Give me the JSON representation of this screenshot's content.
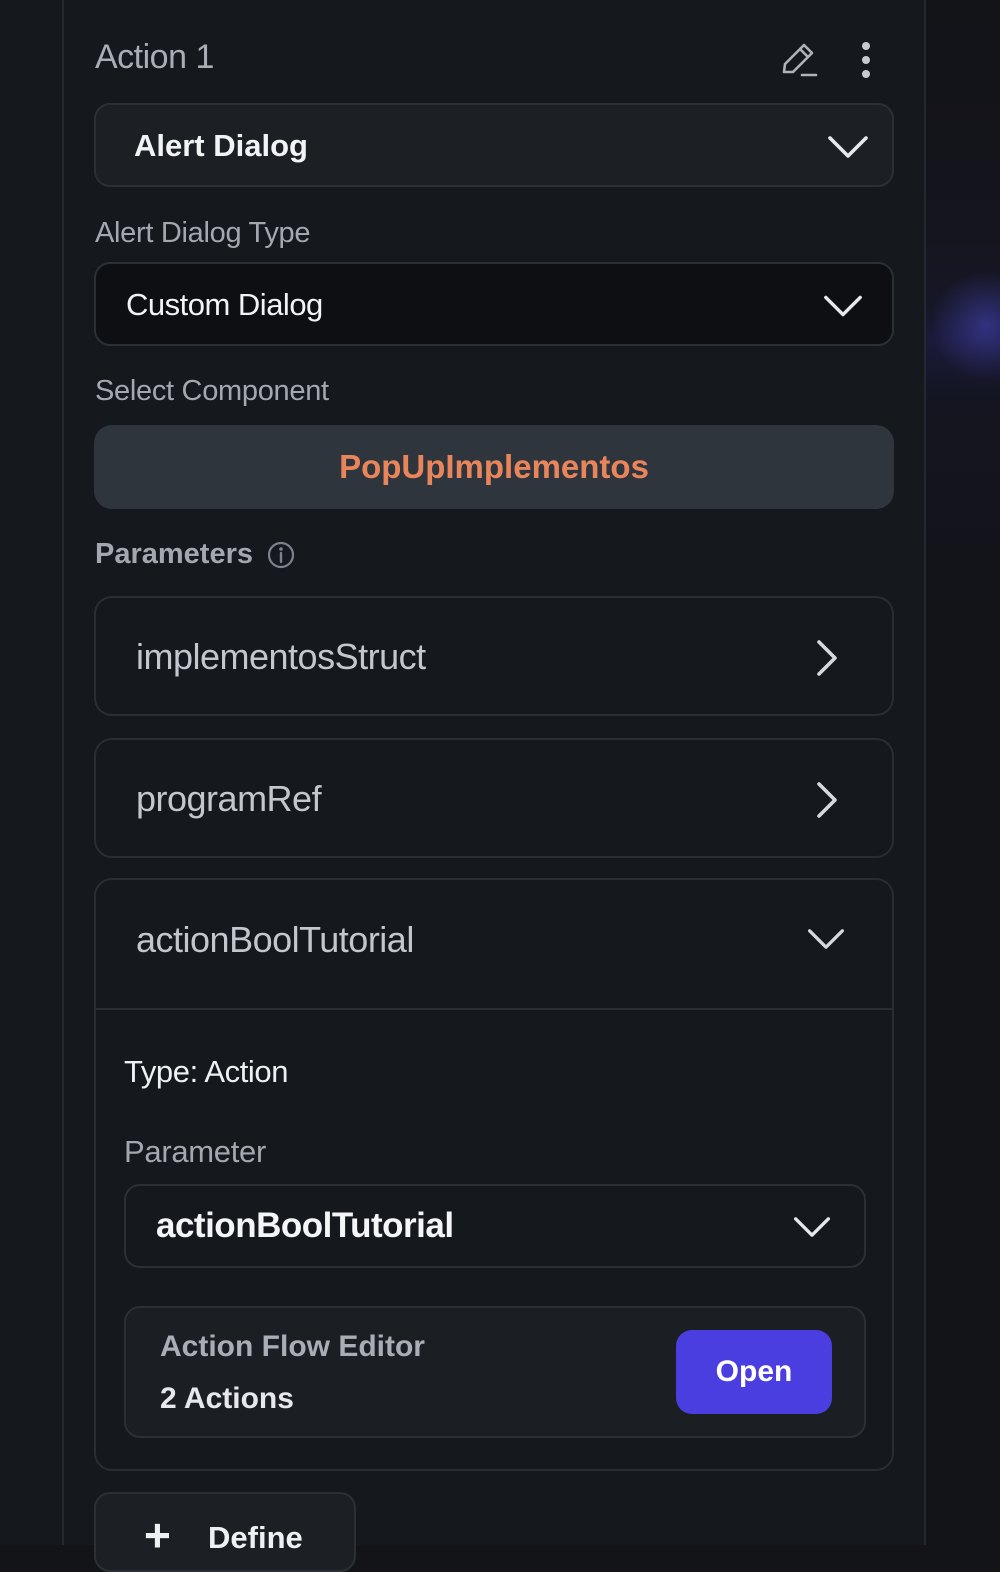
{
  "action": {
    "title": "Action 1",
    "edit_icon": "pencil-icon",
    "more_icon": "more-vertical-icon",
    "action_type": "Alert Dialog"
  },
  "alert_dialog_type": {
    "label": "Alert Dialog Type",
    "value": "Custom Dialog"
  },
  "select_component": {
    "label": "Select Component",
    "value": "PopUpImplementos",
    "value_color": "#e9855a"
  },
  "parameters": {
    "label": "Parameters",
    "info_icon": "info-icon",
    "items": [
      {
        "name": "implementosStruct"
      },
      {
        "name": "programRef"
      }
    ],
    "expanded": {
      "name": "actionBoolTutorial",
      "type_label": "Type: Action",
      "parameter_label": "Parameter",
      "parameter_value": "actionBoolTutorial",
      "action_flow_editor": {
        "title": "Action Flow Editor",
        "count": "2 Actions",
        "open_label": "Open",
        "open_color": "#4b3ee0"
      }
    }
  },
  "define_button": {
    "label": "Define"
  }
}
